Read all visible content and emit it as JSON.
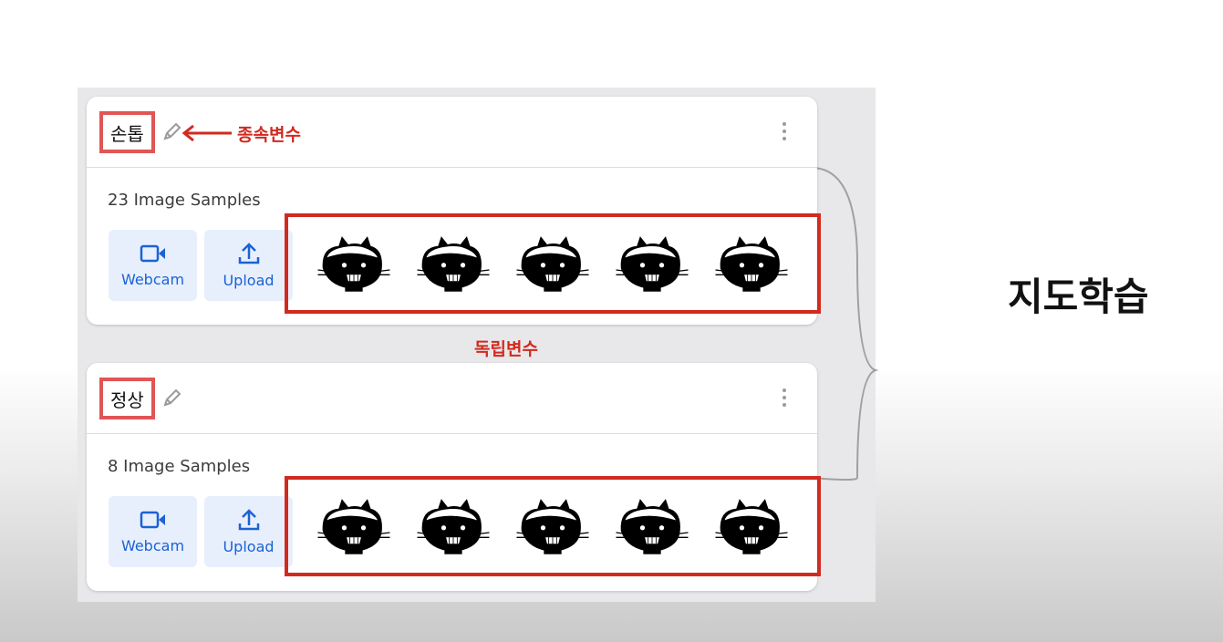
{
  "side_title": "지도학습",
  "annotations": {
    "dependent_variable": "종속변수",
    "independent_variable": "독립변수"
  },
  "classes": [
    {
      "name": "손톱",
      "samples_text": "23 Image Samples",
      "webcam_label": "Webcam",
      "upload_label": "Upload"
    },
    {
      "name": "정상",
      "samples_text": "8 Image Samples",
      "webcam_label": "Webcam",
      "upload_label": "Upload"
    }
  ],
  "colors": {
    "accent_red": "#d12a1f",
    "button_blue": "#1a62d6",
    "button_bg": "#e8effc"
  },
  "icons": [
    "pencil-icon",
    "kebab-menu-icon",
    "webcam-icon",
    "upload-icon",
    "arrow-left-icon"
  ]
}
